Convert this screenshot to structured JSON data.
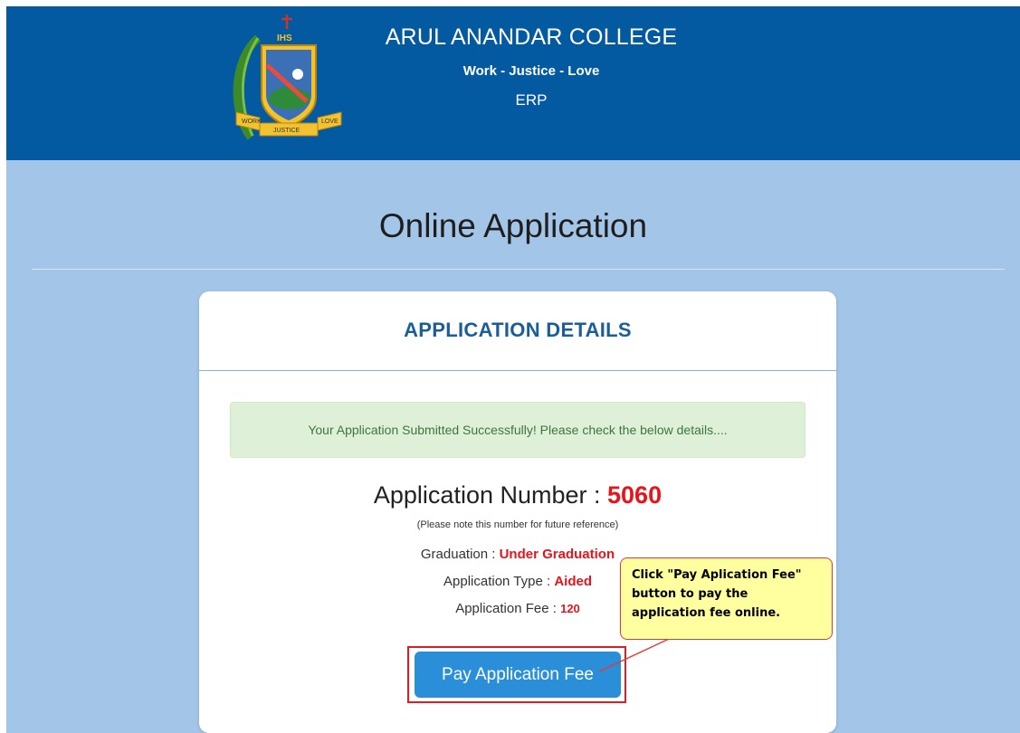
{
  "header": {
    "college_name": "ARUL ANANDAR COLLEGE",
    "motto": "Work - Justice - Love",
    "system": "ERP",
    "logo_text": {
      "monogram": "IHS",
      "ribbon_left": "WORK",
      "ribbon_center": "JUSTICE",
      "ribbon_right": "LOVE",
      "band": "ARUL ANANDAR COLLEGE"
    }
  },
  "page": {
    "title": "Online Application"
  },
  "card": {
    "title": "APPLICATION DETAILS",
    "alert": "Your Application Submitted Successfully! Please check the below details....",
    "app_number_label": "Application Number : ",
    "app_number": "5060",
    "note": "(Please note this number for future reference)",
    "graduation_label": "Graduation : ",
    "graduation_value": "Under Graduation",
    "type_label": "Application Type : ",
    "type_value": "Aided",
    "fee_label": "Application Fee : ",
    "fee_value": "120",
    "pay_button": "Pay Application Fee"
  },
  "callout": {
    "line1": "Click \"Pay Aplication Fee\"",
    "line2": "button to pay the",
    "line3": "application fee online."
  },
  "colors": {
    "header_bg": "#035aa0",
    "page_bg": "#a3c6e8",
    "accent_red": "#e8131b",
    "button_blue": "#2a8fd8",
    "alert_bg": "#dff0d8"
  }
}
